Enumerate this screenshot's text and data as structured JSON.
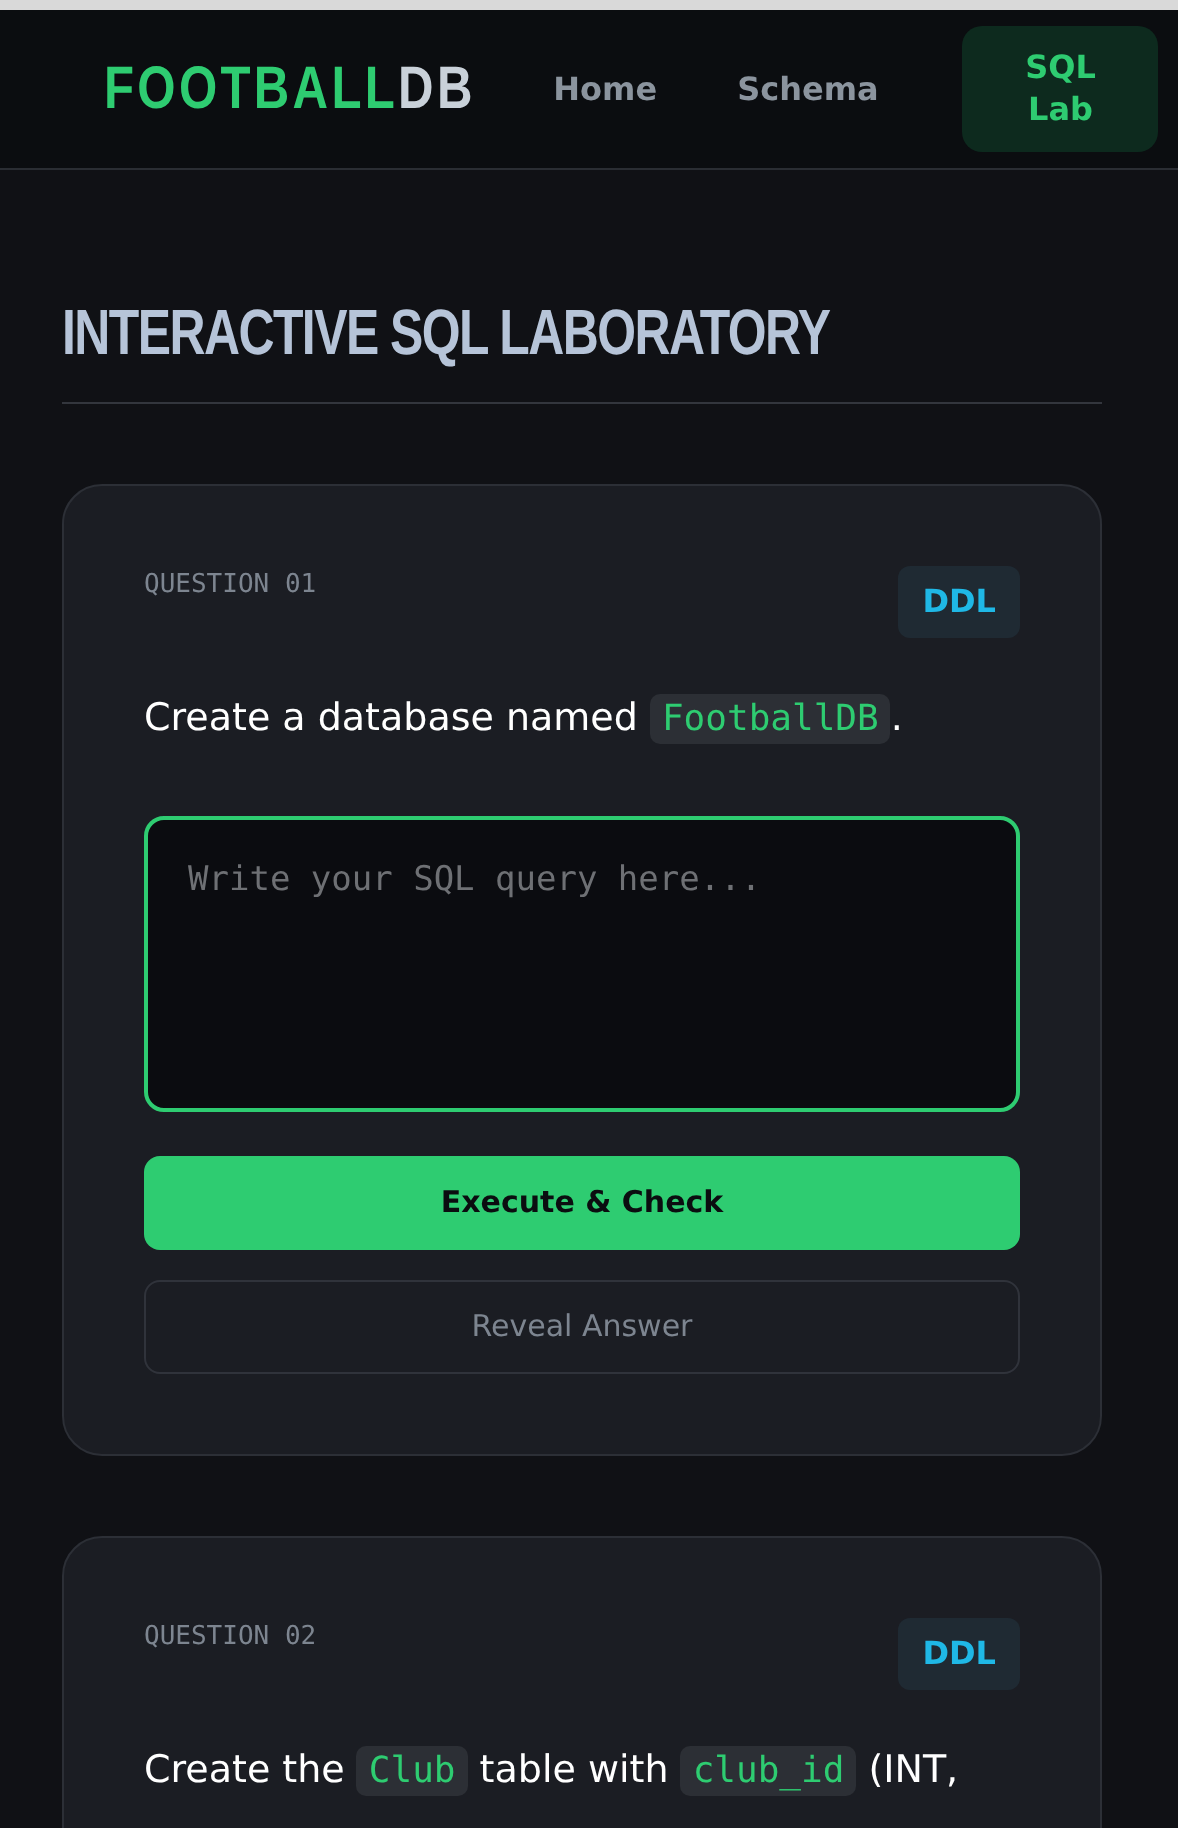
{
  "navbar": {
    "logo": [
      {
        "text": "FOOTBALL",
        "kind": "accent"
      },
      {
        "text": "DB",
        "kind": "plain"
      }
    ],
    "links": [
      {
        "label": "Home",
        "selected": false
      },
      {
        "label": "Schema",
        "selected": false
      },
      {
        "label": "SQL Lab",
        "selected": true
      }
    ]
  },
  "page": {
    "title": "INTERACTIVE SQL LABORATORY"
  },
  "questions": [
    {
      "label": "QUESTION 01",
      "tag": "DDL",
      "prompt": [
        {
          "kind": "text",
          "text": "Create a database named "
        },
        {
          "kind": "code",
          "text": "FootballDB"
        },
        {
          "kind": "text",
          "text": "."
        }
      ],
      "query": {
        "placeholder": "Write your SQL query here...",
        "focused": true
      },
      "actions": [
        {
          "label": "Execute & Check",
          "kind": "primary"
        },
        {
          "label": "Reveal Answer",
          "kind": "outline"
        }
      ]
    },
    {
      "label": "QUESTION 02",
      "tag": "DDL",
      "prompt": [
        {
          "kind": "text",
          "text": "Create the "
        },
        {
          "kind": "code",
          "text": "Club"
        },
        {
          "kind": "text",
          "text": " table with "
        },
        {
          "kind": "code",
          "text": "club_id"
        },
        {
          "kind": "text",
          "text": " (INT,"
        }
      ]
    }
  ]
}
